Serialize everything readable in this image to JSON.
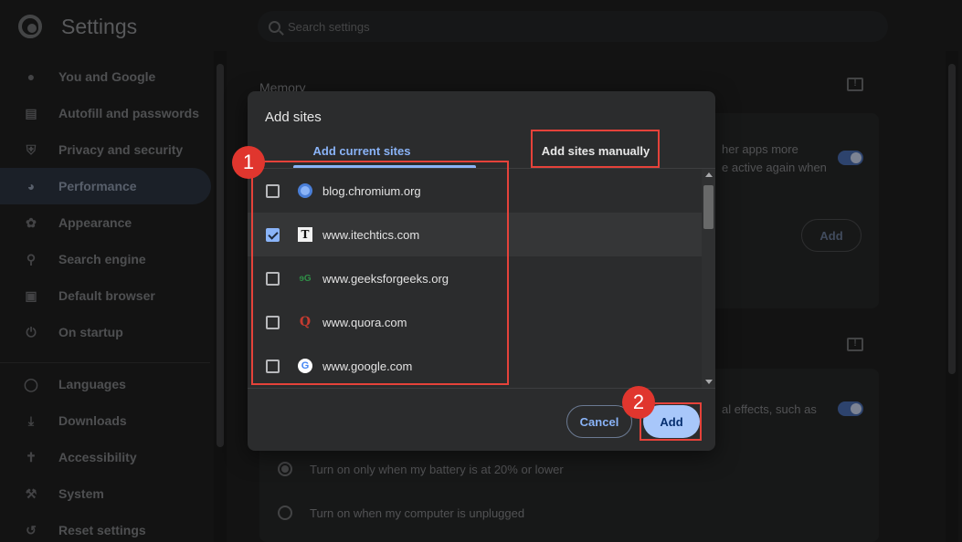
{
  "header": {
    "app_title": "Settings",
    "search_placeholder": "Search settings"
  },
  "sidebar": {
    "items": [
      {
        "label": "You and Google",
        "icon": "person-icon"
      },
      {
        "label": "Autofill and passwords",
        "icon": "clipboard-icon"
      },
      {
        "label": "Privacy and security",
        "icon": "shield-icon"
      },
      {
        "label": "Performance",
        "icon": "speedometer-icon",
        "active": true
      },
      {
        "label": "Appearance",
        "icon": "palette-icon"
      },
      {
        "label": "Search engine",
        "icon": "search-icon"
      },
      {
        "label": "Default browser",
        "icon": "browser-icon"
      },
      {
        "label": "On startup",
        "icon": "power-icon"
      },
      {
        "label": "Languages",
        "icon": "globe-icon"
      },
      {
        "label": "Downloads",
        "icon": "download-icon"
      },
      {
        "label": "Accessibility",
        "icon": "accessibility-icon"
      },
      {
        "label": "System",
        "icon": "wrench-icon"
      },
      {
        "label": "Reset settings",
        "icon": "reset-icon"
      }
    ]
  },
  "main": {
    "memory_title": "Memory",
    "memory_desc_line1": "her apps more",
    "memory_desc_line2": "e active again when",
    "add_label": "Add",
    "power_desc": "al effects, such as",
    "radio_1": "Turn on only when my battery is at 20% or lower",
    "radio_2": "Turn on when my computer is unplugged"
  },
  "dialog": {
    "title": "Add sites",
    "tab_current": "Add current sites",
    "tab_manual": "Add sites manually",
    "sites": [
      {
        "name": "blog.chromium.org",
        "checked": false,
        "icon": "chromium-favicon-icon"
      },
      {
        "name": "www.itechtics.com",
        "checked": true,
        "icon": "itechtics-favicon-icon"
      },
      {
        "name": "www.geeksforgeeks.org",
        "checked": false,
        "icon": "gfg-favicon-icon"
      },
      {
        "name": "www.quora.com",
        "checked": false,
        "icon": "quora-favicon-icon"
      },
      {
        "name": "www.google.com",
        "checked": false,
        "icon": "google-favicon-icon"
      }
    ],
    "favicon_glyphs": {
      "itechtics": "T",
      "gfg": "ɘG",
      "quora": "Q",
      "google": "G"
    },
    "cancel_label": "Cancel",
    "add_label": "Add"
  },
  "callouts": {
    "badge_1": "1",
    "badge_2": "2",
    "color": "#e0362e"
  },
  "colors": {
    "accent": "#8ab4f8",
    "primary_button": "#a8c7fa",
    "background": "#1f2020"
  }
}
